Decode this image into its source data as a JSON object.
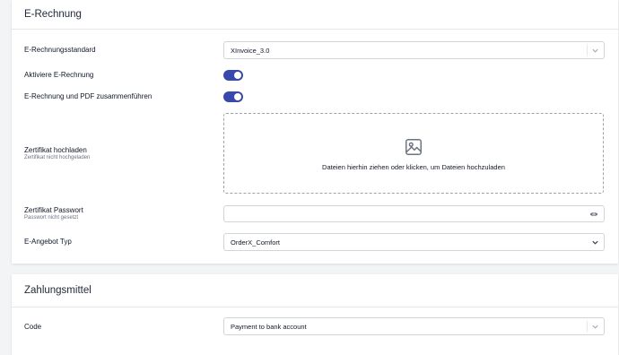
{
  "e_rechnung": {
    "title": "E-Rechnung",
    "standard": {
      "label": "E-Rechnungsstandard",
      "value": "XInvoice_3.0"
    },
    "activate": {
      "label": "Aktiviere E-Rechnung",
      "on": true
    },
    "merge_pdf": {
      "label": "E-Rechnung und PDF zusammenführen",
      "on": true
    },
    "certificate": {
      "label": "Zertifikat hochladen",
      "hint": "Zertifikat nicht hochgeladen",
      "dropzone_text": "Dateien hierhin ziehen oder klicken, um Dateien hochzuladen"
    },
    "password": {
      "label": "Zertifikat Passwort",
      "hint": "Passwort nicht gesetzt",
      "value": ""
    },
    "offer_type": {
      "label": "E-Angebot Typ",
      "value": "OrderX_Comfort"
    }
  },
  "zahlungsmittel": {
    "title": "Zahlungsmittel",
    "code": {
      "label": "Code",
      "value": "Payment to bank account"
    }
  },
  "colors": {
    "toggle_on": "#3949ab",
    "border": "#d1d5db",
    "background": "#f3f4f6"
  }
}
